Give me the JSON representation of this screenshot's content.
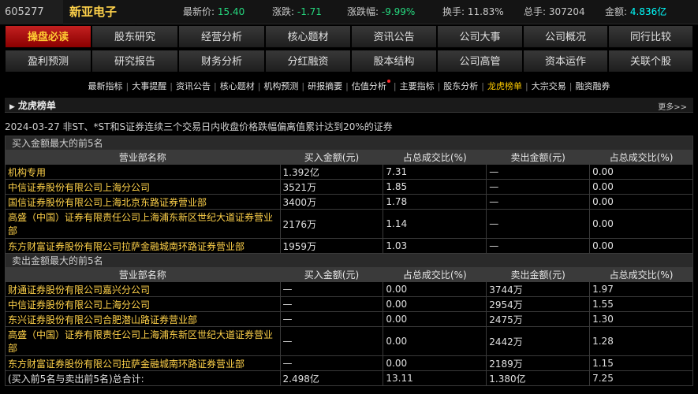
{
  "quote": {
    "code": "605277",
    "name": "新亚电子",
    "items": [
      {
        "label": "最新价:",
        "value": "15.40"
      },
      {
        "label": "涨跌:",
        "value": "-1.71"
      },
      {
        "label": "涨跌幅:",
        "value": "-9.99%"
      },
      {
        "label": "换手:",
        "value": "11.83%"
      },
      {
        "label": "总手:",
        "value": "307204"
      },
      {
        "label": "金额:",
        "value": "4.836亿"
      }
    ]
  },
  "nav": {
    "row1": [
      "操盘必读",
      "股东研究",
      "经营分析",
      "核心题材",
      "资讯公告",
      "公司大事",
      "公司概况",
      "同行比较"
    ],
    "row2": [
      "盈利预测",
      "研究报告",
      "财务分析",
      "分红融资",
      "股本结构",
      "公司高管",
      "资本运作",
      "关联个股"
    ],
    "active": "操盘必读"
  },
  "subnav": {
    "items": [
      "最新指标",
      "大事提醒",
      "资讯公告",
      "核心题材",
      "机构预测",
      "研报摘要",
      "估值分析",
      "主要指标",
      "股东分析",
      "龙虎榜单",
      "大宗交易",
      "融资融券"
    ],
    "active": "龙虎榜单"
  },
  "section": {
    "title": "龙虎榜单",
    "more": "更多>>"
  },
  "date_line": "2024-03-27 非ST、*ST和S证券连续三个交易日内收盘价格跌幅偏离值累计达到20%的证券",
  "headers": [
    "营业部名称",
    "买入金额(元)",
    "占总成交比(%)",
    "卖出金额(元)",
    "占总成交比(%)"
  ],
  "buy_group": "买入金额最大的前5名",
  "buy_rows": [
    {
      "name": "机构专用",
      "buy": "1.392亿",
      "buy_pct": "7.31",
      "sell": "—",
      "sell_pct": "0.00"
    },
    {
      "name": "中信证券股份有限公司上海分公司",
      "buy": "3521万",
      "buy_pct": "1.85",
      "sell": "—",
      "sell_pct": "0.00"
    },
    {
      "name": "国信证券股份有限公司上海北京东路证券营业部",
      "buy": "3400万",
      "buy_pct": "1.78",
      "sell": "—",
      "sell_pct": "0.00"
    },
    {
      "name": "高盛（中国）证券有限责任公司上海浦东新区世纪大道证券营业部",
      "buy": "2176万",
      "buy_pct": "1.14",
      "sell": "—",
      "sell_pct": "0.00"
    },
    {
      "name": "东方财富证券股份有限公司拉萨金融城南环路证券营业部",
      "buy": "1959万",
      "buy_pct": "1.03",
      "sell": "—",
      "sell_pct": "0.00"
    }
  ],
  "sell_group": "卖出金额最大的前5名",
  "sell_rows": [
    {
      "name": "财通证券股份有限公司嘉兴分公司",
      "buy": "—",
      "buy_pct": "0.00",
      "sell": "3744万",
      "sell_pct": "1.97"
    },
    {
      "name": "中信证券股份有限公司上海分公司",
      "buy": "—",
      "buy_pct": "0.00",
      "sell": "2954万",
      "sell_pct": "1.55"
    },
    {
      "name": "东兴证券股份有限公司合肥潜山路证券营业部",
      "buy": "—",
      "buy_pct": "0.00",
      "sell": "2475万",
      "sell_pct": "1.30"
    },
    {
      "name": "高盛（中国）证券有限责任公司上海浦东新区世纪大道证券营业部",
      "buy": "—",
      "buy_pct": "0.00",
      "sell": "2442万",
      "sell_pct": "1.28"
    },
    {
      "name": "东方财富证券股份有限公司拉萨金融城南环路证券营业部",
      "buy": "—",
      "buy_pct": "0.00",
      "sell": "2189万",
      "sell_pct": "1.15"
    }
  ],
  "total": {
    "label": "(买入前5名与卖出前5名)总合计:",
    "buy": "2.498亿",
    "buy_pct": "13.11",
    "sell": "1.380亿",
    "sell_pct": "7.25"
  }
}
